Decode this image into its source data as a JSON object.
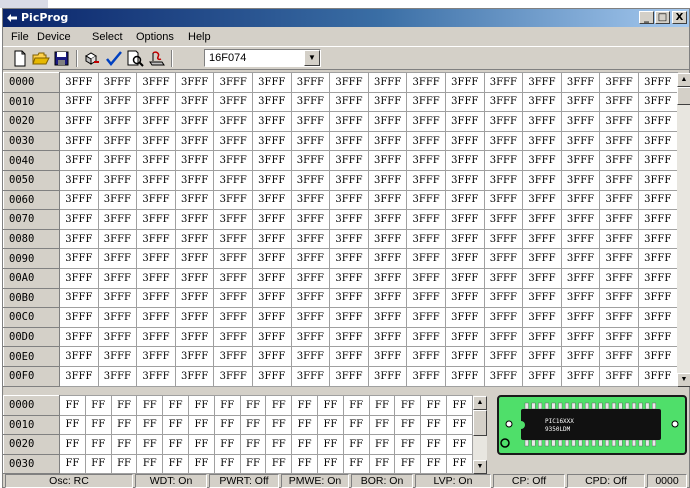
{
  "window": {
    "title": "PicProg"
  },
  "titlebar_buttons": {
    "minimize": "_",
    "maximize": "□",
    "close": "X"
  },
  "menu": [
    "File",
    "Device",
    "Select",
    "Options",
    "Help"
  ],
  "toolbar": {
    "icons": [
      "new-file-icon",
      "open-folder-icon",
      "save-icon",
      "read-chip-icon",
      "verify-check-icon",
      "print-preview-icon",
      "program-chip-icon"
    ],
    "device": "16F074"
  },
  "program_memory": {
    "addresses": [
      "0000",
      "0010",
      "0020",
      "0030",
      "0040",
      "0050",
      "0060",
      "0070",
      "0080",
      "0090",
      "00A0",
      "00B0",
      "00C0",
      "00D0",
      "00E0",
      "00F0"
    ],
    "words_per_row": 16,
    "fill": "3FFF"
  },
  "eeprom": {
    "addresses": [
      "0000",
      "0010",
      "0020",
      "0030"
    ],
    "bytes_per_row": 16,
    "fill": "FF"
  },
  "chip": {
    "line1": "PIC16XXX",
    "line2": "9350LDM"
  },
  "status": [
    "Osc: RC",
    "WDT: On",
    "PWRT: Off",
    "PMWE: On",
    "BOR: On",
    "LVP: On",
    "CP: Off",
    "CPD: Off",
    "0000"
  ],
  "colors": {
    "titlebar_start": "#0a246a",
    "titlebar_end": "#a6caf0",
    "chip_panel": "#4fdf6a",
    "face": "#d4d0c8"
  }
}
